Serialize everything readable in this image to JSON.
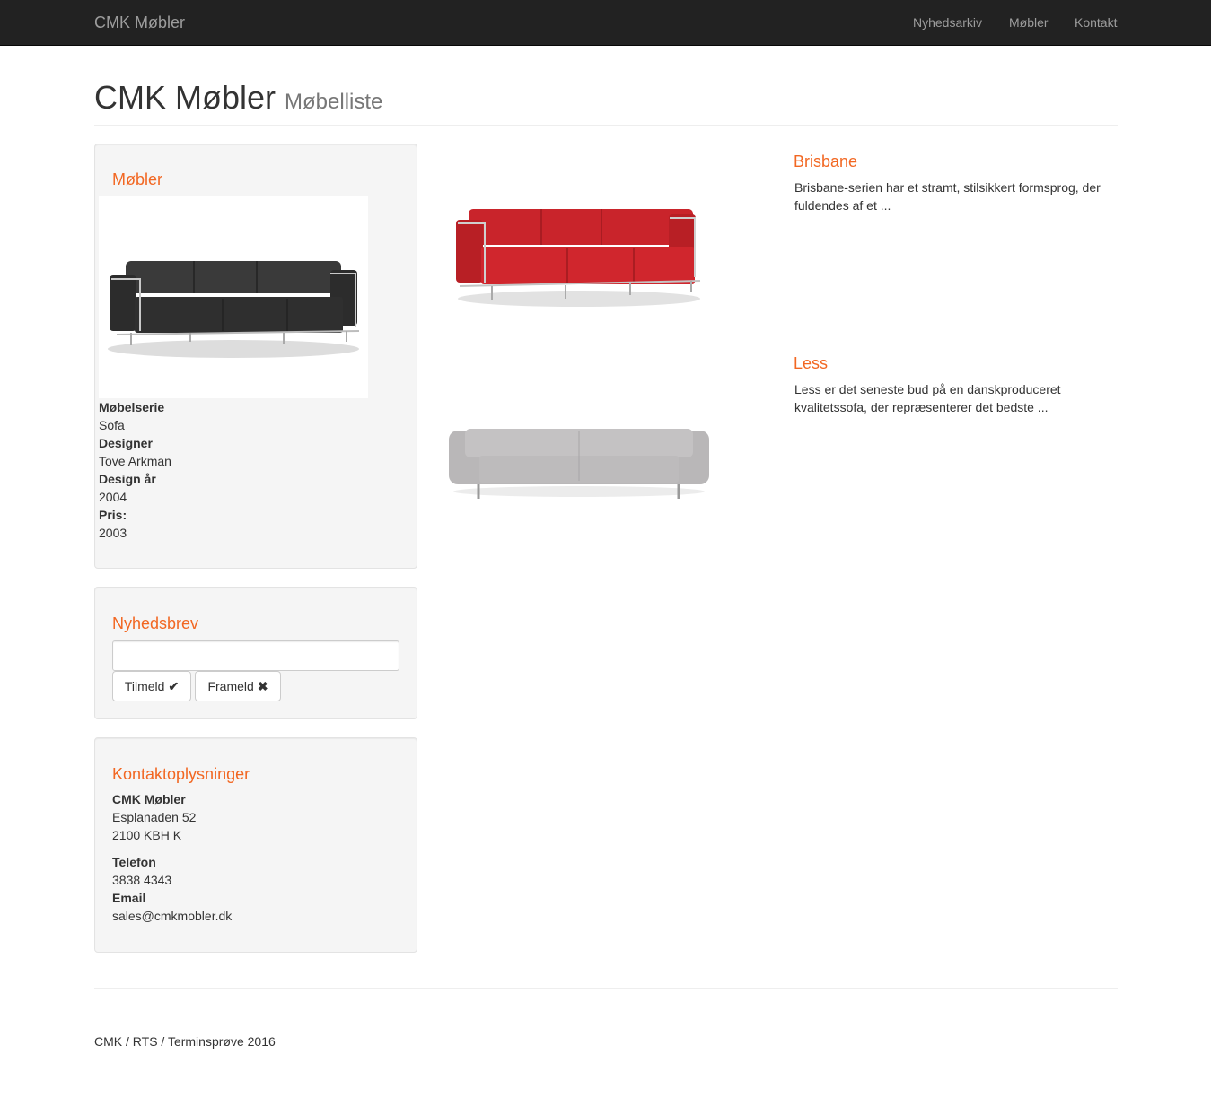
{
  "navbar": {
    "brand": "CMK Møbler",
    "links": [
      "Nyhedsarkiv",
      "Møbler",
      "Kontakt"
    ]
  },
  "header": {
    "title": "CMK Møbler",
    "subtitle": "Møbelliste"
  },
  "sidebar": {
    "furniture": {
      "title": "Møbler",
      "details": [
        {
          "label": "Møbelserie",
          "value": "Sofa"
        },
        {
          "label": "Designer",
          "value": "Tove Arkman"
        },
        {
          "label": "Design år",
          "value": "2004"
        },
        {
          "label": "Pris:",
          "value": "2003"
        }
      ]
    },
    "newsletter": {
      "title": "Nyhedsbrev",
      "input_value": "",
      "subscribe_label": "Tilmeld",
      "unsubscribe_label": "Frameld"
    },
    "contact": {
      "title": "Kontaktoplysninger",
      "company": "CMK Møbler",
      "street": "Esplanaden 52",
      "city": "2100 KBH K",
      "phone_label": "Telefon",
      "phone": "3838 4343",
      "email_label": "Email",
      "email": "sales@cmkmobler.dk"
    }
  },
  "products": [
    {
      "title": "Brisbane",
      "description": "Brisbane-serien har et stramt, stilsikkert formsprog, der fuldendes af et ..."
    },
    {
      "title": "Less",
      "description": "Less er det seneste bud på en danskproduceret kvalitetssofa, der repræsenterer det bedste ..."
    }
  ],
  "footer": {
    "text": "CMK / RTS / Terminsprøve 2016"
  },
  "colors": {
    "accent": "#f26722",
    "navbar": "#222222",
    "well": "#f5f5f5"
  },
  "icons": {
    "subscribe": "check-icon",
    "unsubscribe": "remove-icon"
  }
}
